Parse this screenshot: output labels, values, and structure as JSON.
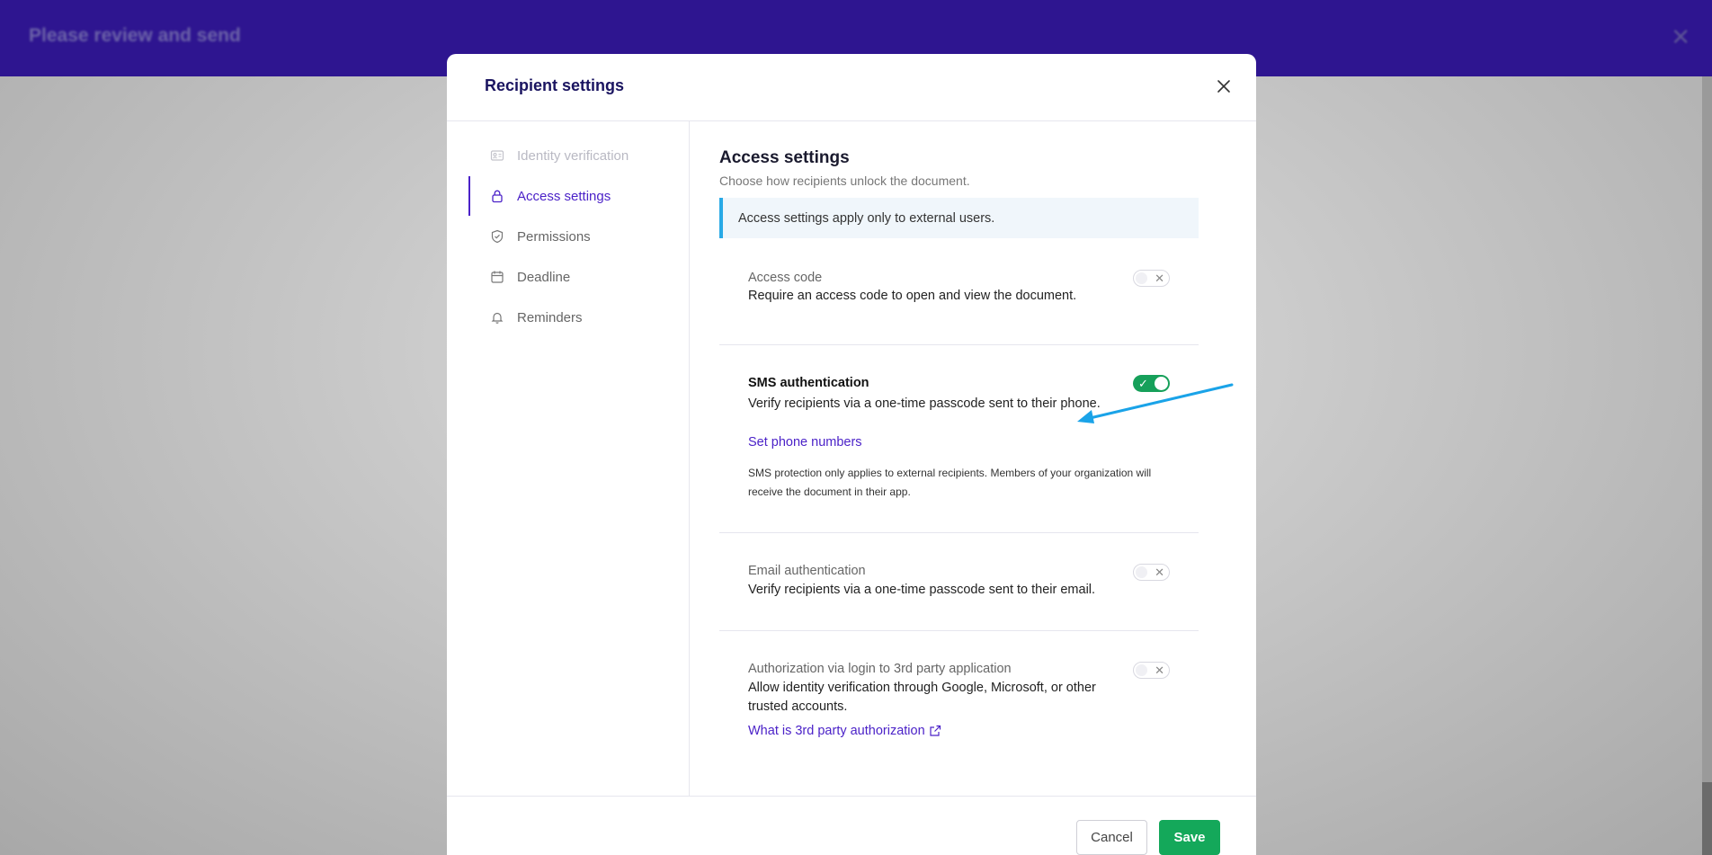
{
  "background": {
    "title": "Please review and send",
    "close_glyph": "✕"
  },
  "modal": {
    "title": "Recipient settings",
    "close_icon": "close-icon"
  },
  "sidebar": {
    "items": [
      {
        "label": "Identity verification",
        "icon": "id-card-icon",
        "state": "disabled"
      },
      {
        "label": "Access settings",
        "icon": "lock-icon",
        "state": "active"
      },
      {
        "label": "Permissions",
        "icon": "shield-icon",
        "state": "normal"
      },
      {
        "label": "Deadline",
        "icon": "calendar-icon",
        "state": "normal"
      },
      {
        "label": "Reminders",
        "icon": "bell-icon",
        "state": "normal"
      }
    ]
  },
  "content": {
    "title": "Access settings",
    "subtitle": "Choose how recipients unlock the document.",
    "info": "Access settings apply only to external users.",
    "settings": [
      {
        "title": "Access code",
        "description": "Require an access code to open and view the document.",
        "enabled": false
      },
      {
        "title": "SMS authentication",
        "description": "Verify recipients via a one-time passcode sent to their phone.",
        "enabled": true,
        "link": "Set phone numbers",
        "note": "SMS protection only applies to external recipients. Members of your organization will receive the document in their app."
      },
      {
        "title": "Email authentication",
        "description": "Verify recipients via a one-time passcode sent to their email.",
        "enabled": false
      },
      {
        "title": "Authorization via login to 3rd party application",
        "description": "Allow identity verification through Google, Microsoft, or other trusted accounts.",
        "enabled": false,
        "link": "What is 3rd party authorization"
      }
    ]
  },
  "toggle": {
    "on_mark": "✓",
    "off_mark": "✕"
  },
  "footer": {
    "cancel_label": "Cancel",
    "save_label": "Save"
  },
  "colors": {
    "accent": "#4b22c8",
    "header": "#2e1590",
    "success": "#16a05a",
    "info_border": "#29a9e6",
    "annotation_arrow": "#1aa3e8"
  }
}
